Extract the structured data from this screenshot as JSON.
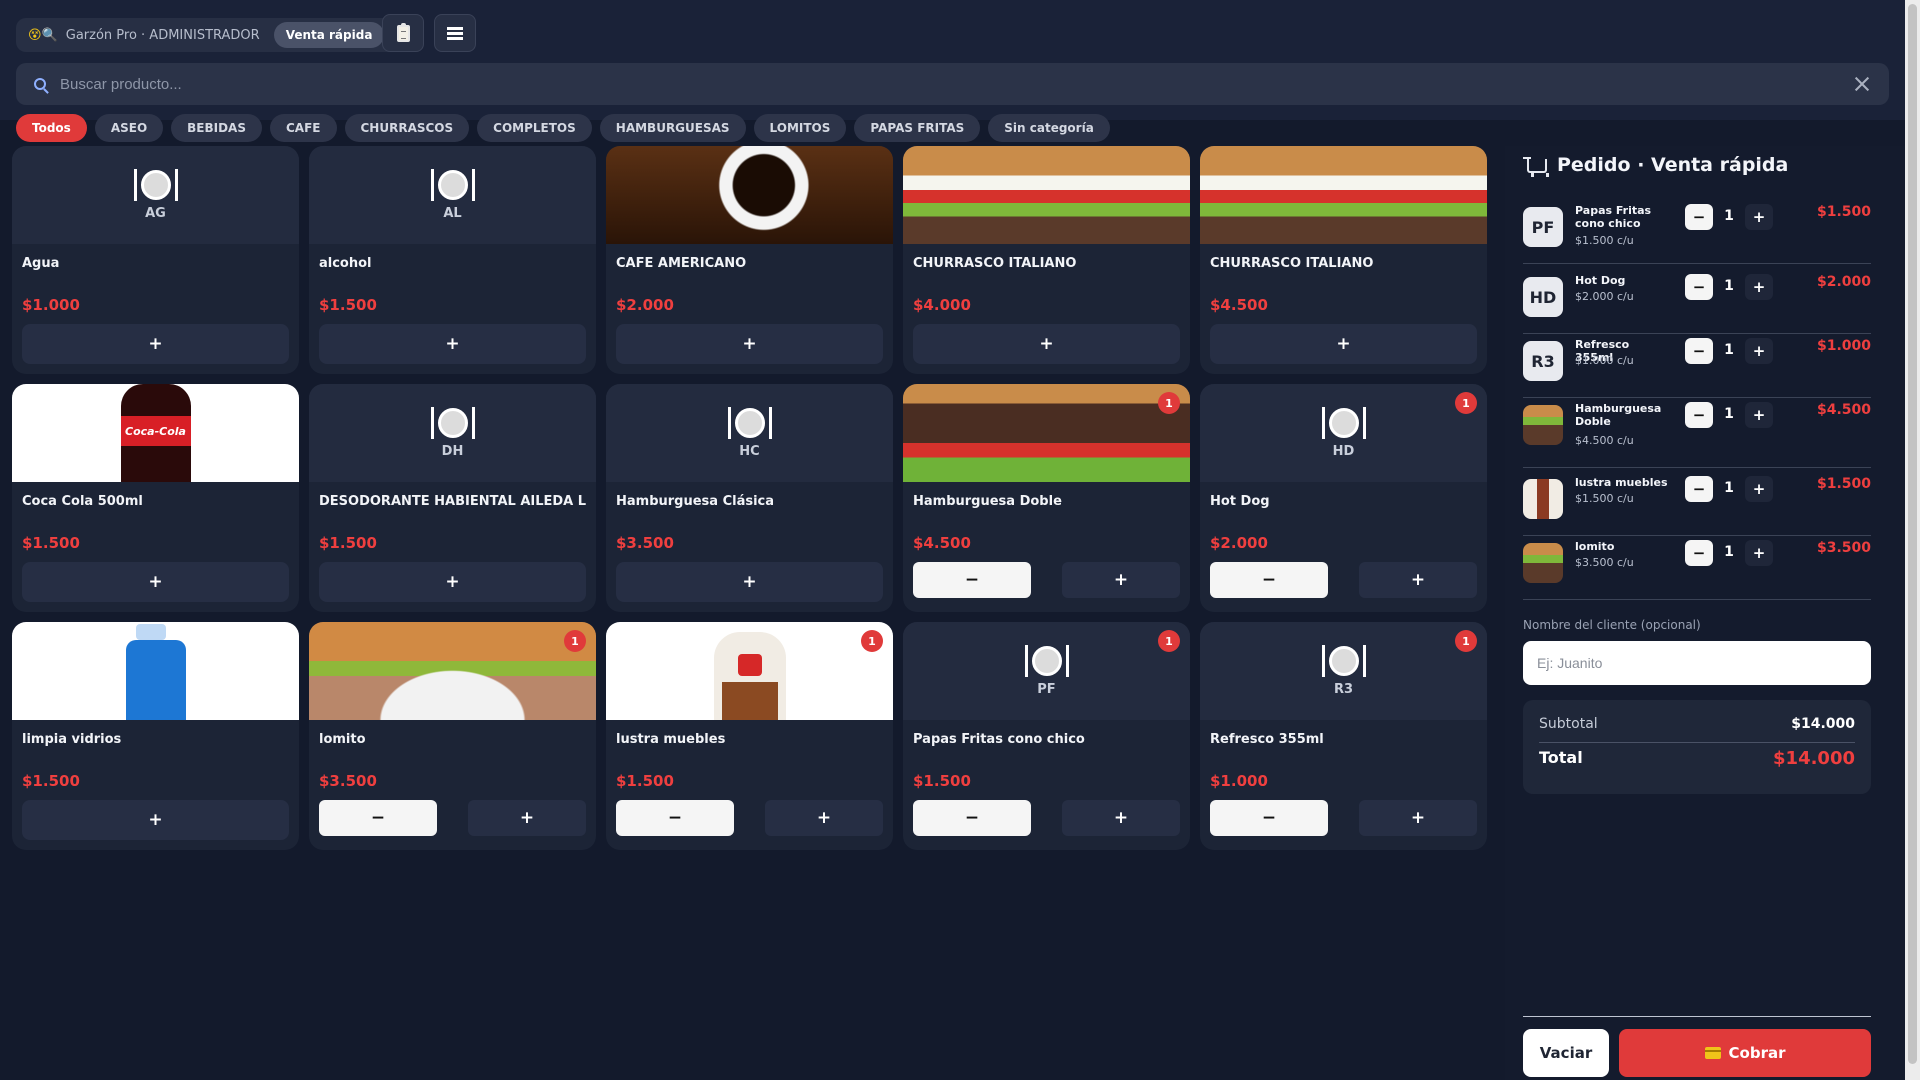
{
  "header": {
    "brand_icons": "😵🔍",
    "app_title": "Garzón Pro · ADMINISTRADOR",
    "mode_label": "Venta rápida"
  },
  "search": {
    "placeholder": "Buscar producto..."
  },
  "categories": [
    "Todos",
    "ASEO",
    "BEBIDAS",
    "CAFE",
    "CHURRASCOS",
    "COMPLETOS",
    "HAMBURGUESAS",
    "LOMITOS",
    "PAPAS FRITAS",
    "Sin categoría"
  ],
  "products": [
    {
      "name": "Agua",
      "price": "$1.000",
      "initials": "AG"
    },
    {
      "name": "alcohol",
      "price": "$1.500",
      "initials": "AL"
    },
    {
      "name": "CAFE AMERICANO",
      "price": "$2.000"
    },
    {
      "name": "CHURRASCO ITALIANO",
      "price": "$4.000"
    },
    {
      "name": "CHURRASCO ITALIANO",
      "price": "$4.500"
    },
    {
      "name": "Coca Cola 500ml",
      "price": "$1.500",
      "label": "Coca-Cola"
    },
    {
      "name": "DESODORANTE HABIENTAL AILEDA LIMON",
      "price": "$1.500",
      "initials": "DH"
    },
    {
      "name": "Hamburguesa Clásica",
      "price": "$3.500",
      "initials": "HC"
    },
    {
      "name": "Hamburguesa Doble",
      "price": "$4.500",
      "badge": "1"
    },
    {
      "name": "Hot Dog",
      "price": "$2.000",
      "initials": "HD",
      "badge": "1"
    },
    {
      "name": "limpia vidrios",
      "price": "$1.500"
    },
    {
      "name": "lomito",
      "price": "$3.500",
      "badge": "1"
    },
    {
      "name": "lustra muebles",
      "price": "$1.500",
      "badge": "1"
    },
    {
      "name": "Papas Fritas cono chico",
      "price": "$1.500",
      "initials": "PF",
      "badge": "1"
    },
    {
      "name": "Refresco 355ml",
      "price": "$1.000",
      "initials": "R3",
      "badge": "1"
    }
  ],
  "buttons": {
    "add": "+",
    "minus": "−",
    "plus": "+"
  },
  "order": {
    "title": "Pedido · Venta rápida",
    "items": [
      {
        "avatar": "PF",
        "name": "Papas Fritas cono chico",
        "unit": "$1.500 c/u",
        "qty": "1",
        "price": "$1.500"
      },
      {
        "avatar": "HD",
        "name": "Hot Dog",
        "unit": "$2.000 c/u",
        "qty": "1",
        "price": "$2.000"
      },
      {
        "avatar": "R3",
        "name": "Refresco 355ml",
        "unit": "$1.000 c/u",
        "qty": "1",
        "price": "$1.000"
      },
      {
        "avatar": "",
        "name": "Hamburguesa Doble",
        "unit": "$4.500 c/u",
        "qty": "1",
        "price": "$4.500"
      },
      {
        "avatar": "",
        "name": "lustra muebles",
        "unit": "$1.500 c/u",
        "qty": "1",
        "price": "$1.500"
      },
      {
        "avatar": "",
        "name": "lomito",
        "unit": "$3.500 c/u",
        "qty": "1",
        "price": "$3.500"
      }
    ],
    "customer_label": "Nombre del cliente (opcional)",
    "customer_placeholder": "Ej: Juanito",
    "subtotal_label": "Subtotal",
    "subtotal_value": "$14.000",
    "total_label": "Total",
    "total_value": "$14.000",
    "clear_label": "Vaciar",
    "charge_label": "Cobrar"
  },
  "colors": {
    "accent": "#e03a3a",
    "background": "#131a2c",
    "card": "#1c2436",
    "price": "#ef3f3f"
  }
}
